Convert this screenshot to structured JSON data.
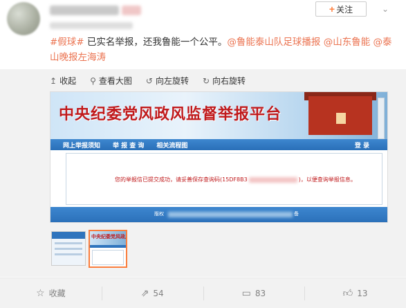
{
  "header": {
    "follow_label": "关注",
    "follow_icon": "+",
    "menu_icon": "chevron-down-icon"
  },
  "post": {
    "tag": "#假球#",
    "text": " 已实名举报，还我鲁能一个公平。",
    "mention1": "@鲁能泰山队足球播报",
    "mention2": "@山东鲁能",
    "mention3": "@泰山晚报左海涛"
  },
  "media_toolbar": {
    "collapse": "收起",
    "view_large": "查看大图",
    "rotate_left": "向左旋转",
    "rotate_right": "向右旋转"
  },
  "screenshot": {
    "title": "中央纪委党风政风监督举报平台",
    "nav": [
      "网上举报须知",
      "举 报 查 询",
      "相关流程图"
    ],
    "login": "登 录",
    "notice_prefix": "您的举报信已提交成功，请妥善保存查询码(15DF8B3",
    "notice_suffix": ")，以便查询举报信息。",
    "footer_label": "版权",
    "footer_suffix": "备"
  },
  "thumbs": {
    "thumb2_title": "中央纪委党风政风监督举报平台"
  },
  "actions": {
    "favorite": "收藏",
    "repost": "54",
    "comment": "83",
    "like": "13"
  }
}
